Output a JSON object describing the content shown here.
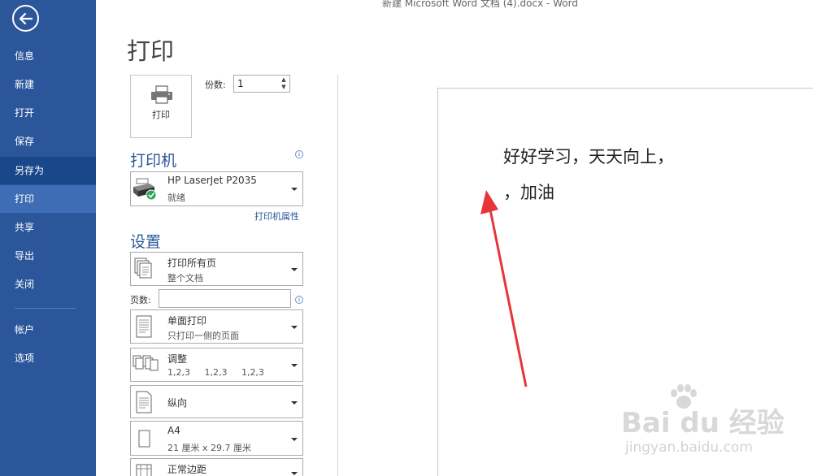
{
  "window": {
    "title": "新建 Microsoft Word 文档 (4).docx - Word"
  },
  "sidebar": {
    "items": [
      {
        "label": "信息"
      },
      {
        "label": "新建"
      },
      {
        "label": "打开"
      },
      {
        "label": "保存"
      },
      {
        "label": "另存为"
      },
      {
        "label": "打印"
      },
      {
        "label": "共享"
      },
      {
        "label": "导出"
      },
      {
        "label": "关闭"
      },
      {
        "label": "帐户"
      },
      {
        "label": "选项"
      }
    ],
    "active": "打印"
  },
  "print": {
    "title": "打印",
    "button_label": "打印",
    "copies_label": "份数:",
    "copies_value": "1"
  },
  "printer": {
    "section_title": "打印机",
    "name": "HP LaserJet P2035",
    "status": "就绪",
    "properties_link": "打印机属性"
  },
  "settings": {
    "section_title": "设置",
    "range": {
      "line1": "打印所有页",
      "line2": "整个文档"
    },
    "pages_label": "页数:",
    "pages_value": "",
    "sides": {
      "line1": "单面打印",
      "line2": "只打印一侧的页面"
    },
    "collate": {
      "line1": "调整",
      "line2": "1,2,3     1,2,3     1,2,3"
    },
    "orientation": {
      "line1": "纵向"
    },
    "paper": {
      "line1": "A4",
      "line2": "21 厘米 x 29.7 厘米"
    },
    "margins": {
      "line1": "正常边距"
    }
  },
  "preview": {
    "line1": "好好学习，天天向上，",
    "line2": "，加油"
  },
  "watermark": {
    "logo": "Bai  du 经验",
    "url": "jingyan.baidu.com"
  },
  "colors": {
    "sidebar": "#2b579a",
    "active": "#3e6db5",
    "accent": "#2b579a",
    "annotation_arrow": "#e8333a"
  }
}
